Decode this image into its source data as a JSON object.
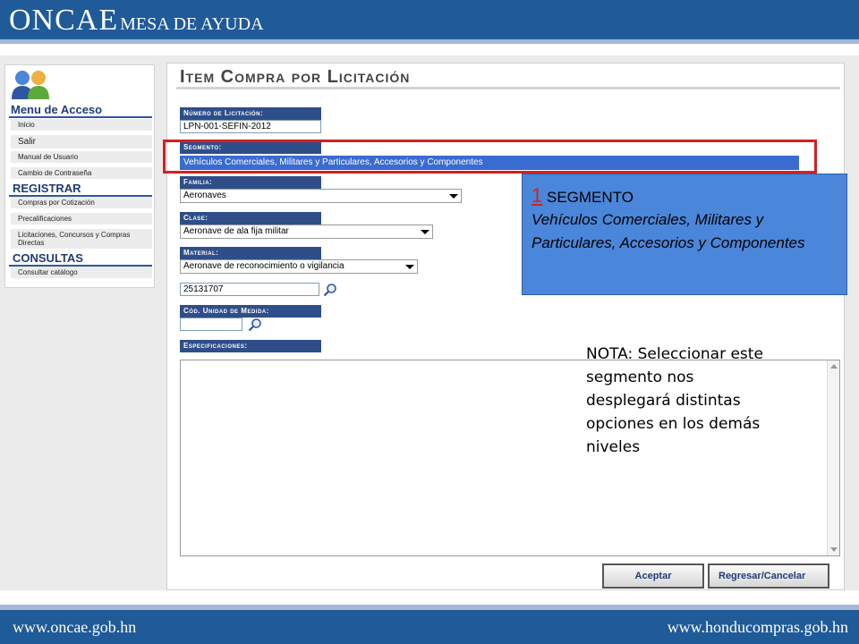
{
  "brand": {
    "main": "ONCAE",
    "sub": "MESA DE AYUDA"
  },
  "footer": {
    "left_url": "www.oncae.gob.hn",
    "right_url": "www.honducompras.gob.hn"
  },
  "sidebar": {
    "menu_title": "Menu de Acceso",
    "items_top": [
      "Inicio",
      "Salir",
      "Manual de Usuario",
      "Cambio de Contraseña"
    ],
    "section_registrar": "REGISTRAR",
    "items_registrar": [
      "Compras por Cotización",
      "Precalificaciones",
      "Licitaciones, Concursos y Compras Directas"
    ],
    "section_consultas": "CONSULTAS",
    "items_consultas": [
      "Consultar catálogo"
    ]
  },
  "page": {
    "title": "Item Compra por Licitación",
    "numero_label": "Número de Licitación:",
    "numero_value": "LPN-001-SEFIN-2012",
    "segmento_label": "Segmento:",
    "segmento_value": "Vehículos Comerciales, Militares y Particulares, Accesorios y Componentes",
    "familia_label": "Familia:",
    "familia_value": "Aeronaves",
    "clase_label": "Clase:",
    "clase_value": "Aeronave de ala fija militar",
    "material_label": "Material:",
    "material_value": "Aeronave de reconocimiento o vigilancia",
    "material_code": "25131707",
    "unidad_label": "Cód. Unidad de Medida:",
    "unidad_value": "",
    "especificaciones_label": "Especificaciones:",
    "accept_label": "Aceptar",
    "back_label": "Regresar/Cancelar"
  },
  "callout": {
    "number": "1",
    "heading": "SEGMENTO",
    "body": "Vehículos Comerciales, Militares y Particulares, Accesorios y Componentes"
  },
  "nota": "NOTA: Seleccionar este segmento nos desplegará distintas opciones en los demás niveles",
  "colors": {
    "header_blue": "#1f5a99",
    "label_blue": "#2e4e8a",
    "callout_blue": "#4a86da",
    "highlight_red": "#d42020"
  }
}
